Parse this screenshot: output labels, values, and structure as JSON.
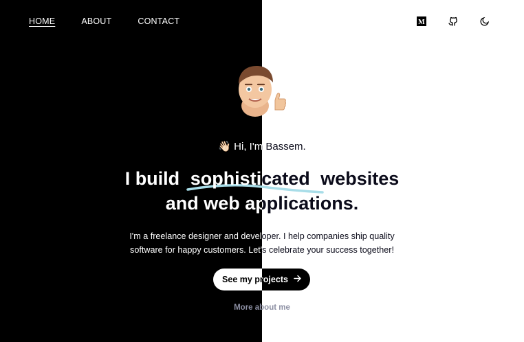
{
  "nav": {
    "home": "HOME",
    "about": "ABOUT",
    "contact": "CONTACT"
  },
  "header_icons": [
    "medium-icon",
    "github-icon",
    "moon-icon"
  ],
  "hero": {
    "greeting_emoji": "👋🏻",
    "greeting_text": "Hi, I'm Bassem.",
    "headline_before": "I build",
    "headline_highlight": "sophisticated",
    "headline_after": "websites",
    "headline_line2": "and web applications.",
    "intro_line1": "I'm a freelance designer and developer. I help companies ship quality",
    "intro_line2": "software for happy customers. Let's celebrate your success together!",
    "cta_label": "See my projects",
    "more_link": "More about me"
  },
  "colors": {
    "dark_bg": "#000000",
    "light_bg": "#ffffff",
    "accent_squiggle": "#a8dde8",
    "muted_link": "#8c8fa3"
  }
}
